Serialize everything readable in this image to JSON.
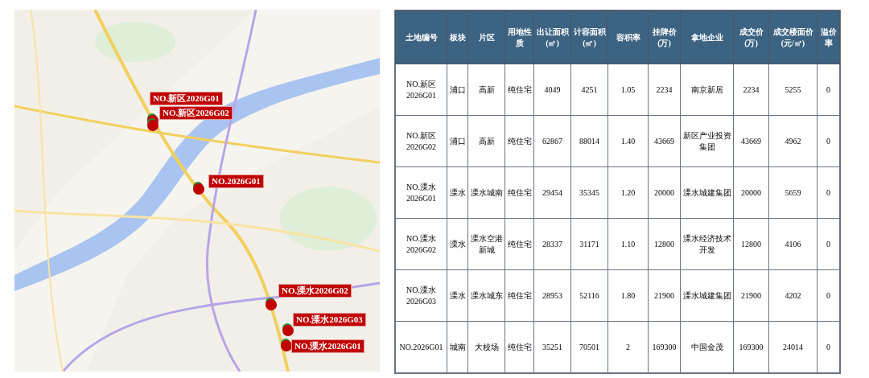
{
  "map": {
    "markers": [
      {
        "label": "NO.新区2026G01"
      },
      {
        "label": "NO.新区2026G02"
      },
      {
        "label": "NO.2026G01"
      },
      {
        "label": "NO.溧水2026G02"
      },
      {
        "label": "NO.溧水2026G03"
      },
      {
        "label": "NO.溧水2026G01"
      }
    ]
  },
  "table": {
    "columns": [
      "土地编号",
      "板块",
      "片区",
      "用地性质",
      "出让面积(㎡)",
      "计容面积(㎡)",
      "容积率",
      "挂牌价(万)",
      "拿地企业",
      "成交价(万)",
      "成交楼面价(元/㎡)",
      "溢价率"
    ],
    "rows": [
      [
        "NO.新区2026G01",
        "浦口",
        "高新",
        "纯住宅",
        "4049",
        "4251",
        "1.05",
        "2234",
        "南京新居",
        "2234",
        "5255",
        "0"
      ],
      [
        "NO.新区2026G02",
        "浦口",
        "高新",
        "纯住宅",
        "62867",
        "88014",
        "1.40",
        "43669",
        "新区产业投资集团",
        "43669",
        "4962",
        "0"
      ],
      [
        "NO.溧水2026G01",
        "溧水",
        "溧水城南",
        "纯住宅",
        "29454",
        "35345",
        "1.20",
        "20000",
        "溧水城建集团",
        "20000",
        "5659",
        "0"
      ],
      [
        "NO.溧水2026G02",
        "溧水",
        "溧水空港新城",
        "纯住宅",
        "28337",
        "31171",
        "1.10",
        "12800",
        "溧水经济技术开发",
        "12800",
        "4106",
        "0"
      ],
      [
        "NO.溧水2026G03",
        "溧水",
        "溧水城东",
        "纯住宅",
        "28953",
        "52116",
        "1.80",
        "21900",
        "溧水城建集团",
        "21900",
        "4202",
        "0"
      ],
      [
        "NO.2026G01",
        "城南",
        "大校场",
        "纯住宅",
        "35251",
        "70501",
        "2",
        "169300",
        "中国金茂",
        "169300",
        "24014",
        "0"
      ]
    ]
  }
}
